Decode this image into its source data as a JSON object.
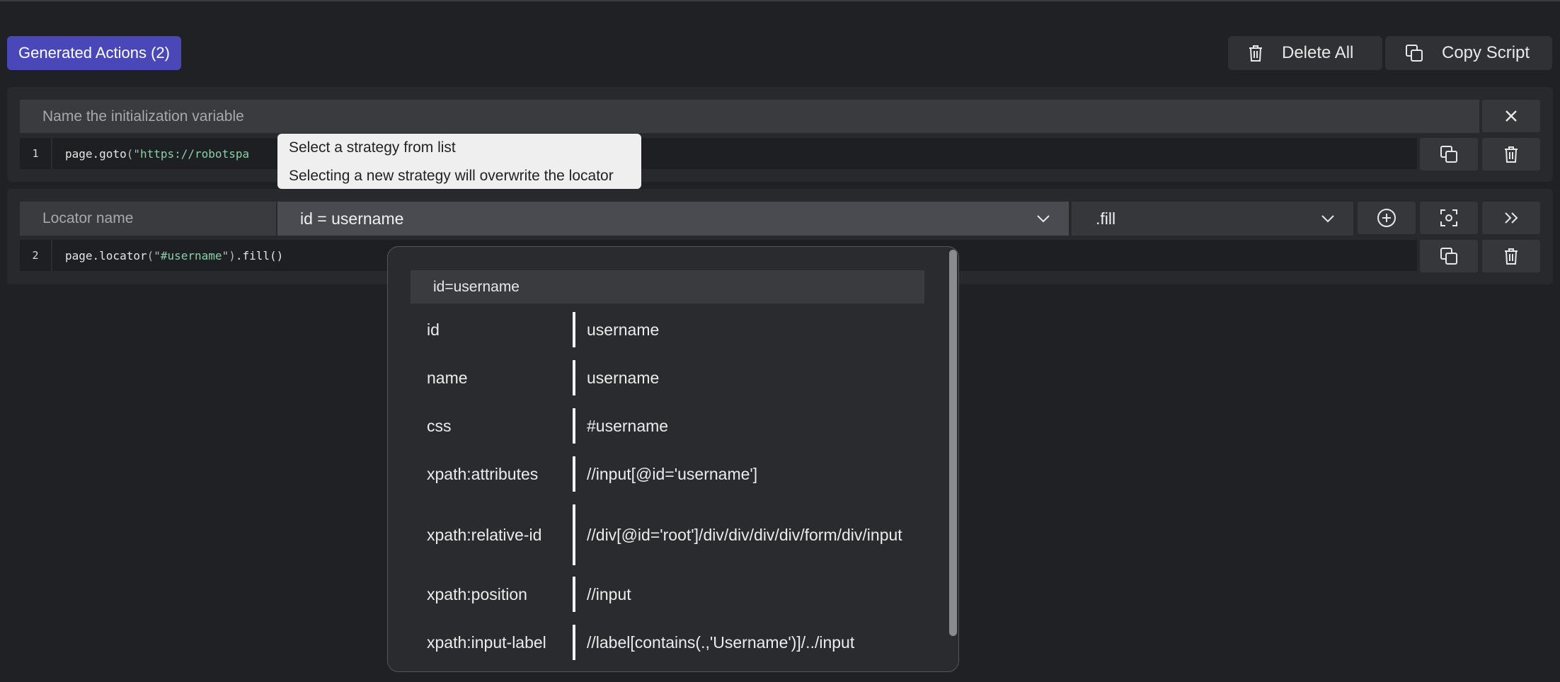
{
  "header": {
    "badge_label": "Generated Actions (2)",
    "delete_all_label": "Delete All",
    "copy_script_label": "Copy Script"
  },
  "init_block": {
    "variable_placeholder": "Name the initialization variable",
    "line_number": "1",
    "code_fn": "page.goto",
    "code_open": "(\"",
    "code_arg": "https://robotspa",
    "code_close": ""
  },
  "tooltip": {
    "line1": "Select a strategy from list",
    "line2": "Selecting a new strategy will overwrite the locator"
  },
  "locator_block": {
    "name_placeholder": "Locator name",
    "strategy_value": "id = username",
    "action_value": ".fill",
    "line_number": "2",
    "code_fn": "page.locator",
    "code_open": "(\"",
    "code_arg": "#username",
    "code_close": "\")",
    "code_tail": ".fill()"
  },
  "strategy_dropdown": {
    "header": "id=username",
    "options": [
      {
        "key": "id",
        "value": "username"
      },
      {
        "key": "name",
        "value": "username"
      },
      {
        "key": "css",
        "value": "#username"
      },
      {
        "key": "xpath:attributes",
        "value": "//input[@id='username']"
      },
      {
        "key": "xpath:relative-id",
        "value": "//div[@id='root']/div/div/div/div/form/div/input"
      },
      {
        "key": "xpath:position",
        "value": "//input"
      },
      {
        "key": "xpath:input-label",
        "value": "//label[contains(.,'Username')]/../input"
      }
    ]
  },
  "icons": {
    "delete_all": "trash-icon",
    "copy_script": "copy-icon",
    "close": "close-icon",
    "copy": "copy-icon",
    "delete": "trash-icon",
    "add": "plus-circle-icon",
    "capture": "focus-capture-icon",
    "expand": "double-chevron-right-icon",
    "dropdown": "chevron-down-icon"
  },
  "colors": {
    "accent": "#4a48b8",
    "background": "#202124",
    "string": "#8ccfa8"
  }
}
